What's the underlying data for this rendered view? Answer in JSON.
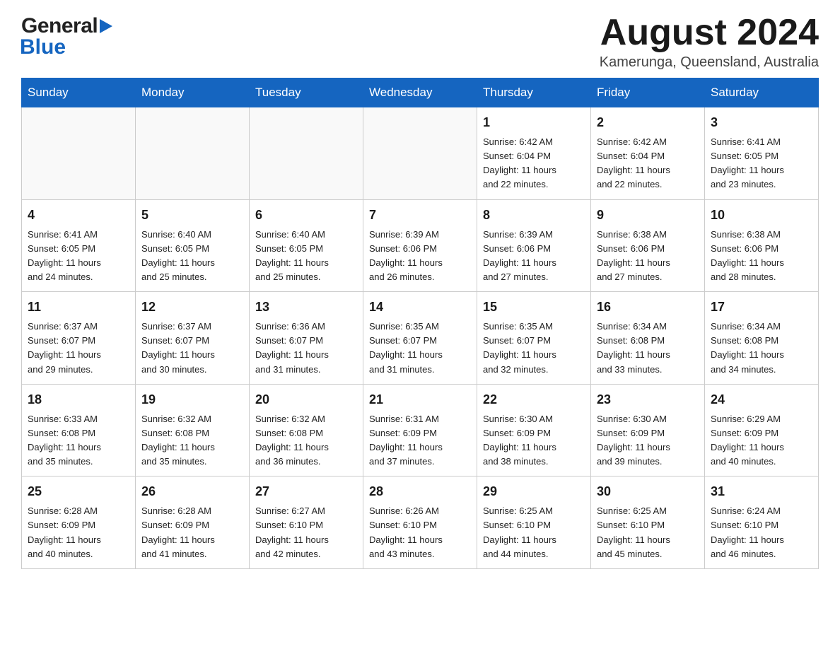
{
  "header": {
    "logo_general": "General",
    "logo_blue": "Blue",
    "month_year": "August 2024",
    "location": "Kamerunga, Queensland, Australia"
  },
  "days_of_week": [
    "Sunday",
    "Monday",
    "Tuesday",
    "Wednesday",
    "Thursday",
    "Friday",
    "Saturday"
  ],
  "weeks": [
    [
      {
        "day": "",
        "info": ""
      },
      {
        "day": "",
        "info": ""
      },
      {
        "day": "",
        "info": ""
      },
      {
        "day": "",
        "info": ""
      },
      {
        "day": "1",
        "info": "Sunrise: 6:42 AM\nSunset: 6:04 PM\nDaylight: 11 hours\nand 22 minutes."
      },
      {
        "day": "2",
        "info": "Sunrise: 6:42 AM\nSunset: 6:04 PM\nDaylight: 11 hours\nand 22 minutes."
      },
      {
        "day": "3",
        "info": "Sunrise: 6:41 AM\nSunset: 6:05 PM\nDaylight: 11 hours\nand 23 minutes."
      }
    ],
    [
      {
        "day": "4",
        "info": "Sunrise: 6:41 AM\nSunset: 6:05 PM\nDaylight: 11 hours\nand 24 minutes."
      },
      {
        "day": "5",
        "info": "Sunrise: 6:40 AM\nSunset: 6:05 PM\nDaylight: 11 hours\nand 25 minutes."
      },
      {
        "day": "6",
        "info": "Sunrise: 6:40 AM\nSunset: 6:05 PM\nDaylight: 11 hours\nand 25 minutes."
      },
      {
        "day": "7",
        "info": "Sunrise: 6:39 AM\nSunset: 6:06 PM\nDaylight: 11 hours\nand 26 minutes."
      },
      {
        "day": "8",
        "info": "Sunrise: 6:39 AM\nSunset: 6:06 PM\nDaylight: 11 hours\nand 27 minutes."
      },
      {
        "day": "9",
        "info": "Sunrise: 6:38 AM\nSunset: 6:06 PM\nDaylight: 11 hours\nand 27 minutes."
      },
      {
        "day": "10",
        "info": "Sunrise: 6:38 AM\nSunset: 6:06 PM\nDaylight: 11 hours\nand 28 minutes."
      }
    ],
    [
      {
        "day": "11",
        "info": "Sunrise: 6:37 AM\nSunset: 6:07 PM\nDaylight: 11 hours\nand 29 minutes."
      },
      {
        "day": "12",
        "info": "Sunrise: 6:37 AM\nSunset: 6:07 PM\nDaylight: 11 hours\nand 30 minutes."
      },
      {
        "day": "13",
        "info": "Sunrise: 6:36 AM\nSunset: 6:07 PM\nDaylight: 11 hours\nand 31 minutes."
      },
      {
        "day": "14",
        "info": "Sunrise: 6:35 AM\nSunset: 6:07 PM\nDaylight: 11 hours\nand 31 minutes."
      },
      {
        "day": "15",
        "info": "Sunrise: 6:35 AM\nSunset: 6:07 PM\nDaylight: 11 hours\nand 32 minutes."
      },
      {
        "day": "16",
        "info": "Sunrise: 6:34 AM\nSunset: 6:08 PM\nDaylight: 11 hours\nand 33 minutes."
      },
      {
        "day": "17",
        "info": "Sunrise: 6:34 AM\nSunset: 6:08 PM\nDaylight: 11 hours\nand 34 minutes."
      }
    ],
    [
      {
        "day": "18",
        "info": "Sunrise: 6:33 AM\nSunset: 6:08 PM\nDaylight: 11 hours\nand 35 minutes."
      },
      {
        "day": "19",
        "info": "Sunrise: 6:32 AM\nSunset: 6:08 PM\nDaylight: 11 hours\nand 35 minutes."
      },
      {
        "day": "20",
        "info": "Sunrise: 6:32 AM\nSunset: 6:08 PM\nDaylight: 11 hours\nand 36 minutes."
      },
      {
        "day": "21",
        "info": "Sunrise: 6:31 AM\nSunset: 6:09 PM\nDaylight: 11 hours\nand 37 minutes."
      },
      {
        "day": "22",
        "info": "Sunrise: 6:30 AM\nSunset: 6:09 PM\nDaylight: 11 hours\nand 38 minutes."
      },
      {
        "day": "23",
        "info": "Sunrise: 6:30 AM\nSunset: 6:09 PM\nDaylight: 11 hours\nand 39 minutes."
      },
      {
        "day": "24",
        "info": "Sunrise: 6:29 AM\nSunset: 6:09 PM\nDaylight: 11 hours\nand 40 minutes."
      }
    ],
    [
      {
        "day": "25",
        "info": "Sunrise: 6:28 AM\nSunset: 6:09 PM\nDaylight: 11 hours\nand 40 minutes."
      },
      {
        "day": "26",
        "info": "Sunrise: 6:28 AM\nSunset: 6:09 PM\nDaylight: 11 hours\nand 41 minutes."
      },
      {
        "day": "27",
        "info": "Sunrise: 6:27 AM\nSunset: 6:10 PM\nDaylight: 11 hours\nand 42 minutes."
      },
      {
        "day": "28",
        "info": "Sunrise: 6:26 AM\nSunset: 6:10 PM\nDaylight: 11 hours\nand 43 minutes."
      },
      {
        "day": "29",
        "info": "Sunrise: 6:25 AM\nSunset: 6:10 PM\nDaylight: 11 hours\nand 44 minutes."
      },
      {
        "day": "30",
        "info": "Sunrise: 6:25 AM\nSunset: 6:10 PM\nDaylight: 11 hours\nand 45 minutes."
      },
      {
        "day": "31",
        "info": "Sunrise: 6:24 AM\nSunset: 6:10 PM\nDaylight: 11 hours\nand 46 minutes."
      }
    ]
  ]
}
